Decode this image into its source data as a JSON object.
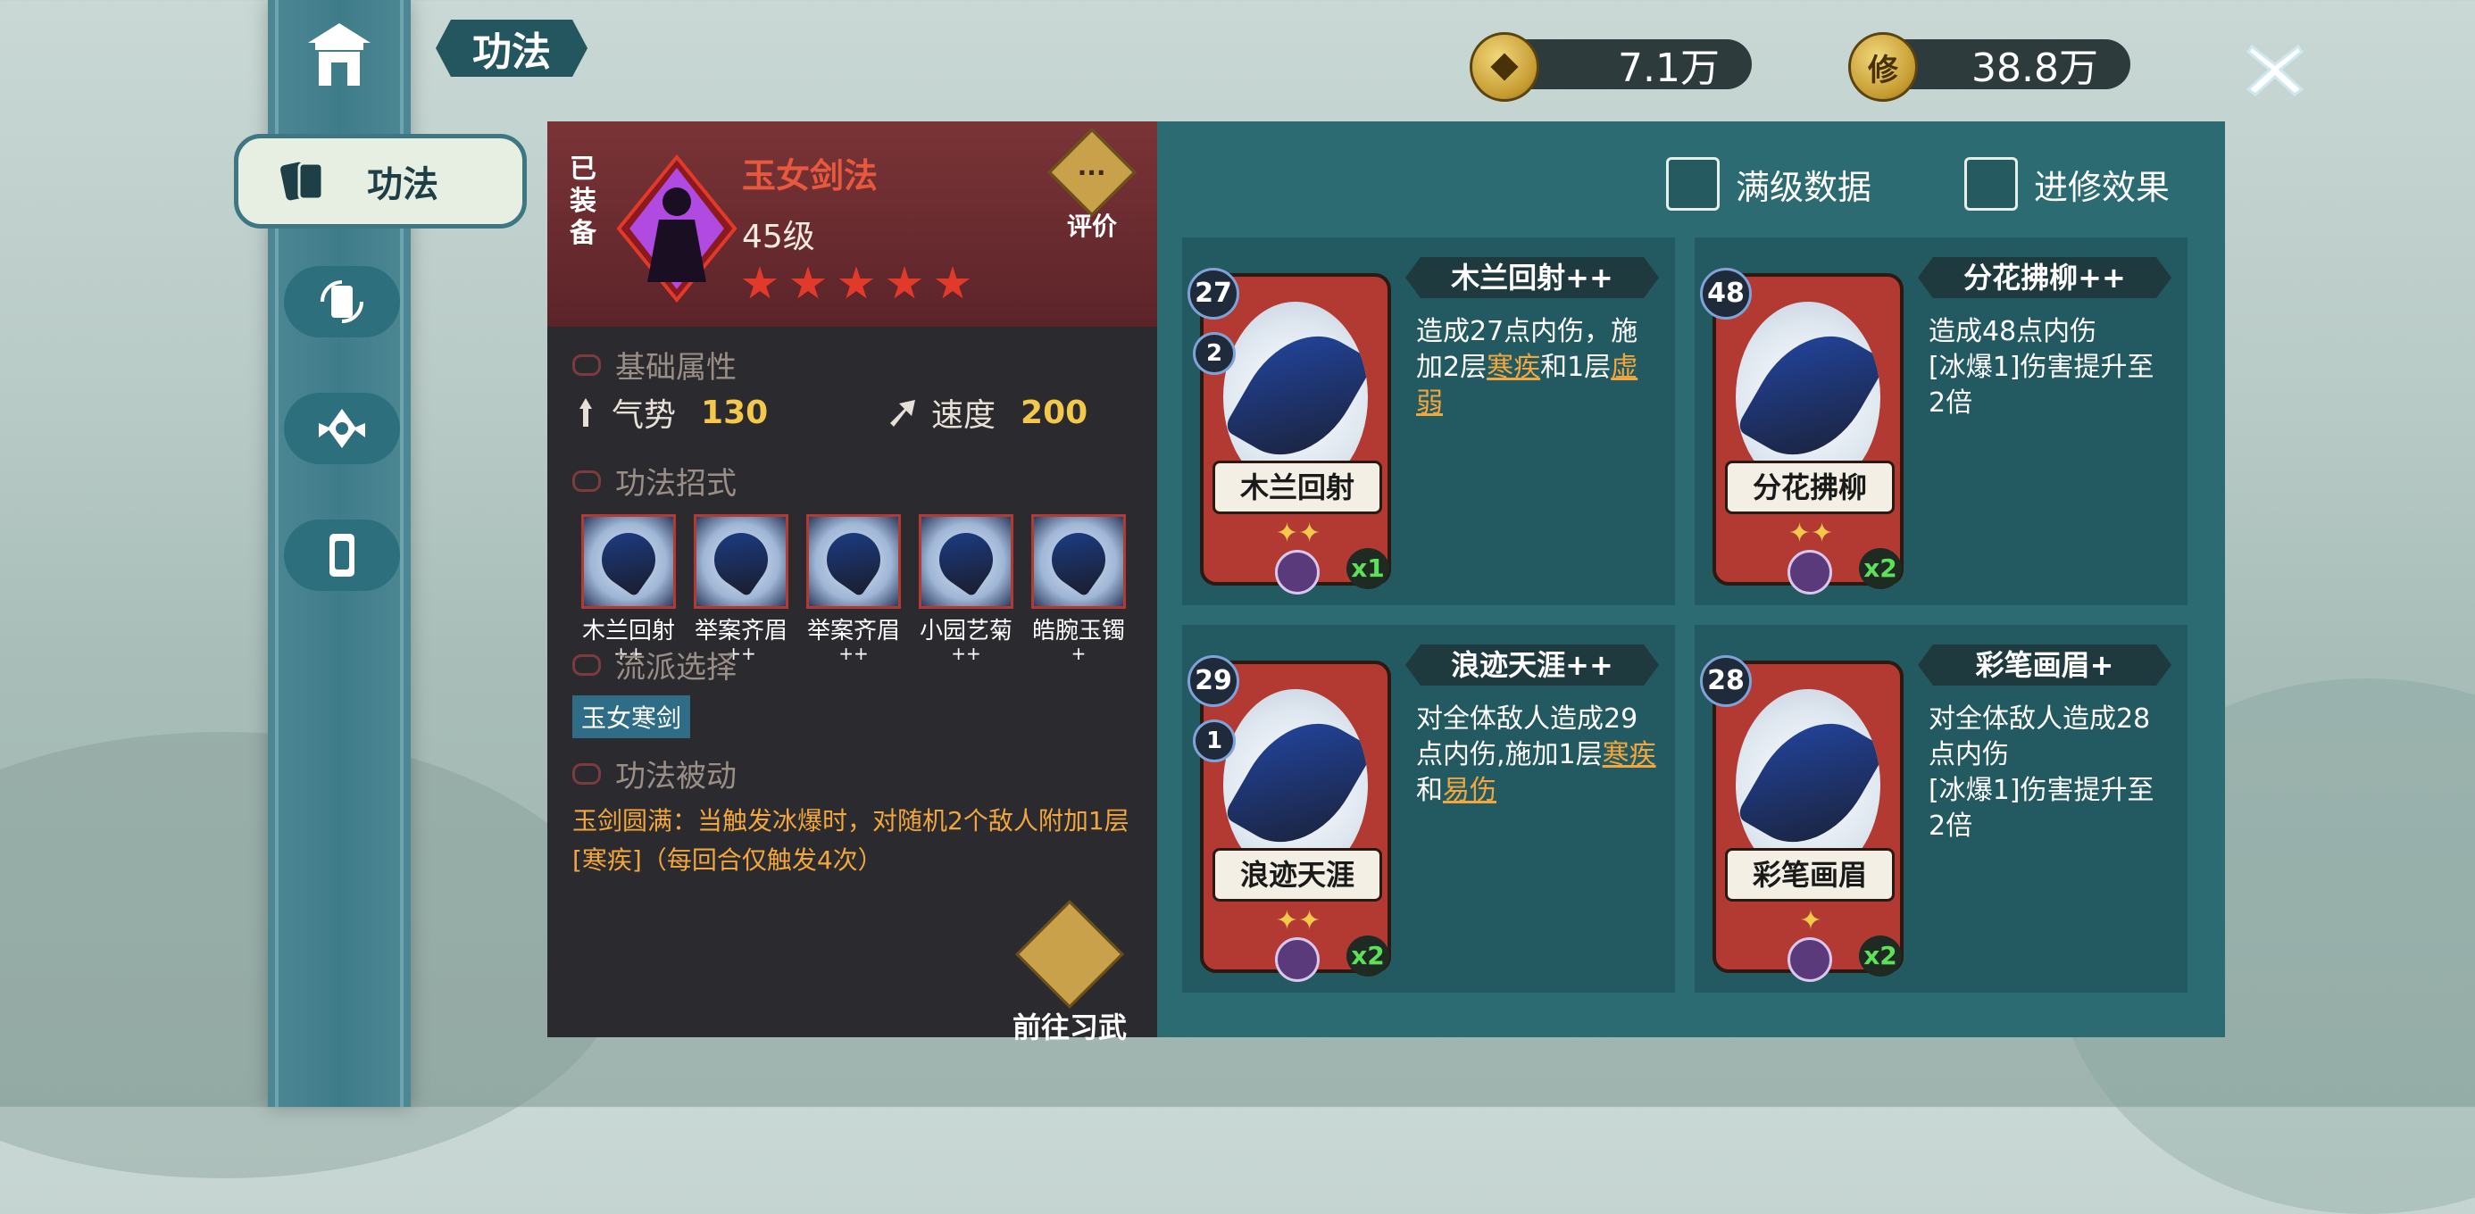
{
  "header": {
    "title": "功法"
  },
  "nav": {
    "active_label": "功法"
  },
  "currency": [
    {
      "icon": "coin-icon",
      "symbol": "",
      "value": "7.1万"
    },
    {
      "icon": "cultivation-coin-icon",
      "symbol": "修",
      "value": "38.8万"
    }
  ],
  "art": {
    "equipped": "已装备",
    "name": "玉女剑法",
    "level": "45级",
    "stars": 5,
    "review_label": "评价"
  },
  "sections": {
    "base": "基础属性",
    "moves": "功法招式",
    "school": "流派选择",
    "passive": "功法被动"
  },
  "stats": [
    {
      "icon": "momentum-icon",
      "label": "气势",
      "value": "130"
    },
    {
      "icon": "speed-icon",
      "label": "速度",
      "value": "200"
    }
  ],
  "moves": [
    {
      "name": "木兰回射",
      "plus": "++"
    },
    {
      "name": "举案齐眉",
      "plus": "++"
    },
    {
      "name": "举案齐眉",
      "plus": "++"
    },
    {
      "name": "小园艺菊",
      "plus": "++"
    },
    {
      "name": "皓腕玉镯",
      "plus": "+"
    }
  ],
  "school_tag": "玉女寒剑",
  "passive_text": "玉剑圆满：当触发冰爆时，对随机2个敌人附加1层[寒疾]（每回合仅触发4次）",
  "goto_label": "前往习武",
  "toggles": {
    "max_data": "满级数据",
    "advance": "进修效果"
  },
  "cards": [
    {
      "title": "木兰回射++",
      "art_label": "木兰回射",
      "cost": "27",
      "sub": "2",
      "upgrade": "✦✦",
      "count": "x1",
      "desc": [
        {
          "t": "造成27点内伤，施加2层"
        },
        {
          "t": "寒疾",
          "link": true
        },
        {
          "t": "和1层"
        },
        {
          "t": "虚弱",
          "link": true
        }
      ]
    },
    {
      "title": "分花拂柳++",
      "art_label": "分花拂柳",
      "cost": "48",
      "sub": "",
      "upgrade": "✦✦",
      "count": "x2",
      "desc": [
        {
          "t": "造成48点内伤\n[冰爆1]伤害提升至2倍"
        }
      ]
    },
    {
      "title": "浪迹天涯++",
      "art_label": "浪迹天涯",
      "cost": "29",
      "sub": "1",
      "upgrade": "✦✦",
      "count": "x2",
      "desc": [
        {
          "t": "对全体敌人造成29点内伤,施加1层"
        },
        {
          "t": "寒疾",
          "link": true
        },
        {
          "t": "和"
        },
        {
          "t": "易伤",
          "link": true
        }
      ]
    },
    {
      "title": "彩笔画眉+",
      "art_label": "彩笔画眉",
      "cost": "28",
      "sub": "",
      "upgrade": "✦",
      "count": "x2",
      "desc": [
        {
          "t": "对全体敌人造成28点内伤\n[冰爆1]伤害提升至2倍"
        }
      ]
    }
  ]
}
